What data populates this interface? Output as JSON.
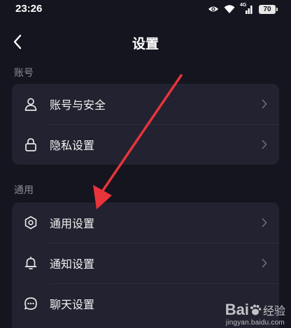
{
  "status_bar": {
    "time": "23:26",
    "network_label": "4G",
    "battery": "70",
    "icons": [
      "eye-icon",
      "wifi-icon",
      "signal-icon",
      "battery-icon"
    ]
  },
  "header": {
    "title": "设置",
    "back_icon": "back-chevron-icon"
  },
  "sections": [
    {
      "title": "账号",
      "items": [
        {
          "label": "账号与安全",
          "icon": "user-icon"
        },
        {
          "label": "隐私设置",
          "icon": "lock-icon"
        }
      ]
    },
    {
      "title": "通用",
      "items": [
        {
          "label": "通用设置",
          "icon": "gear-icon"
        },
        {
          "label": "通知设置",
          "icon": "bell-icon"
        },
        {
          "label": "聊天设置",
          "icon": "chat-icon"
        }
      ]
    }
  ],
  "annotation": {
    "type": "red-arrow",
    "color": "#e8343a",
    "points_to": "通用设置"
  },
  "watermark": {
    "logo_text": "Baidu经验",
    "url": "jingyan.baidu.com"
  },
  "colors": {
    "background": "#15151f",
    "card": "#222230",
    "section_title": "#8a8a94",
    "text": "#f2f2f2"
  }
}
